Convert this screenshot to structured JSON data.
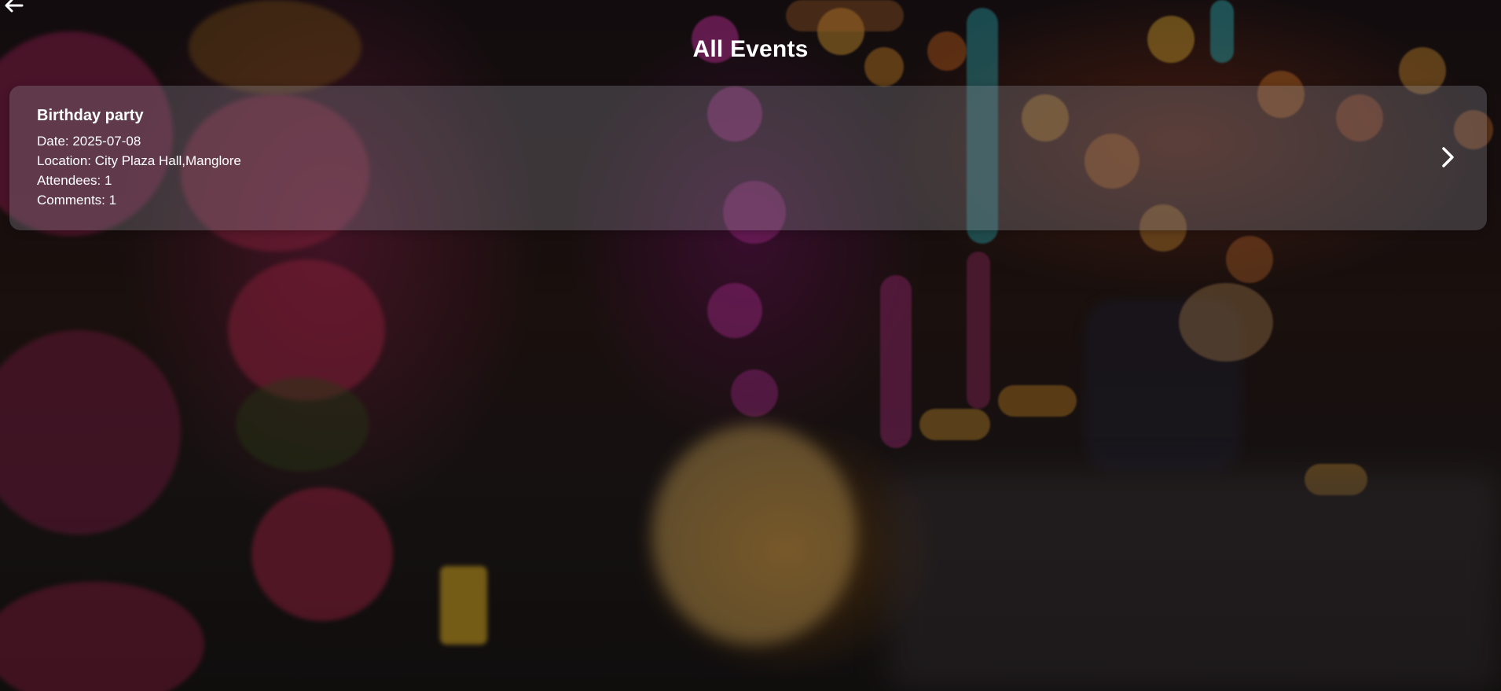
{
  "header": {
    "back_icon": "arrow-left-icon",
    "title": "All Events"
  },
  "events": [
    {
      "name": "Birthday party",
      "date_label": "Date: 2025-07-08",
      "location_label": "Location: City Plaza Hall,Manglore",
      "attendees_label": "Attendees: 1",
      "comments_label": "Comments: 1",
      "chevron_icon": "chevron-right-icon"
    }
  ],
  "colors": {
    "text": "#ffffff",
    "card_background": "rgba(150,150,160,0.30)"
  }
}
